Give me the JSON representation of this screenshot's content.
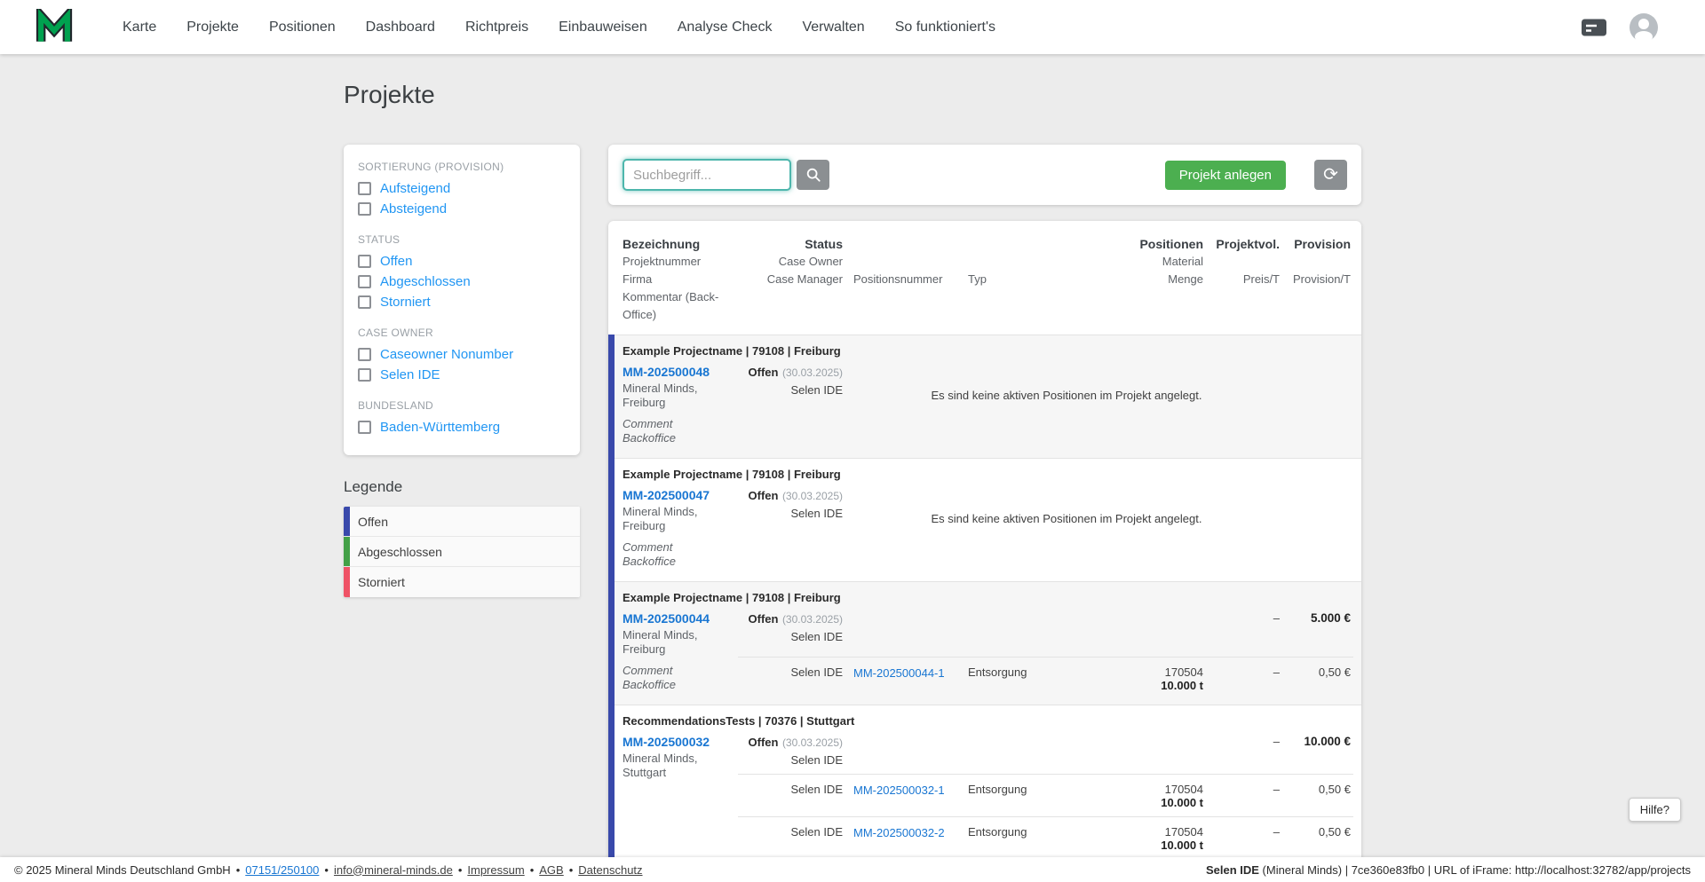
{
  "navbar": {
    "items": [
      "Karte",
      "Projekte",
      "Positionen",
      "Dashboard",
      "Richtpreis",
      "Einbauweisen",
      "Analyse Check",
      "Verwalten",
      "So funktioniert's"
    ]
  },
  "page": {
    "title": "Projekte"
  },
  "filters": {
    "sections": [
      {
        "label": "SORTIERUNG (PROVISION)",
        "options": [
          "Aufsteigend",
          "Absteigend"
        ]
      },
      {
        "label": "STATUS",
        "options": [
          "Offen",
          "Abgeschlossen",
          "Storniert"
        ]
      },
      {
        "label": "CASE OWNER",
        "options": [
          "Caseowner Nonumber",
          "Selen IDE"
        ]
      },
      {
        "label": "BUNDESLAND",
        "options": [
          "Baden-Württemberg"
        ]
      }
    ]
  },
  "legend": {
    "title": "Legende",
    "items": [
      {
        "label": "Offen",
        "color": "#3949ab"
      },
      {
        "label": "Abgeschlossen",
        "color": "#43a047"
      },
      {
        "label": "Storniert",
        "color": "#ef5266"
      }
    ]
  },
  "toolbar": {
    "search_placeholder": "Suchbegriff...",
    "create_button": "Projekt anlegen"
  },
  "icons": {
    "refresh_glyph": "⟳"
  },
  "colors": {
    "primary_green": "#4caf50",
    "status_open": "#3949ab",
    "status_done": "#43a047",
    "status_cancelled": "#ef5266",
    "link_blue": "#1976d2",
    "search_focus_teal": "#4db6ac"
  },
  "table": {
    "header": {
      "bezeichnung": "Bezeichnung",
      "projektnummer": "Projektnummer",
      "firma": "Firma",
      "kommentar": "Kommentar (Back-Office)",
      "status": "Status",
      "case_owner": "Case Owner",
      "case_manager": "Case Manager",
      "positionsnummer": "Positionsnummer",
      "typ": "Typ",
      "positionen": "Positionen",
      "material": "Material",
      "menge": "Menge",
      "projektvol": "Projektvol.",
      "preis_t": "Preis/T",
      "provision": "Provision",
      "provision_t": "Provision/T"
    },
    "projects": [
      {
        "title": "Example Projectname | 79108 | Freiburg",
        "number": "MM-202500048",
        "company": "Mineral Minds, Freiburg",
        "comment": "Comment Backoffice",
        "status": "Offen",
        "status_date": "(30.03.2025)",
        "case_owner": "Selen IDE",
        "projektvol": "",
        "provision": "",
        "empty_message": "Es sind keine aktiven Positionen im Projekt angelegt.",
        "positions": []
      },
      {
        "title": "Example Projectname | 79108 | Freiburg",
        "number": "MM-202500047",
        "company": "Mineral Minds, Freiburg",
        "comment": "Comment Backoffice",
        "status": "Offen",
        "status_date": "(30.03.2025)",
        "case_owner": "Selen IDE",
        "projektvol": "",
        "provision": "",
        "empty_message": "Es sind keine aktiven Positionen im Projekt angelegt.",
        "positions": []
      },
      {
        "title": "Example Projectname | 79108 | Freiburg",
        "number": "MM-202500044",
        "company": "Mineral Minds, Freiburg",
        "comment": "Comment Backoffice",
        "status": "Offen",
        "status_date": "(30.03.2025)",
        "case_owner": "Selen IDE",
        "projektvol": "–",
        "provision": "5.000 €",
        "positions": [
          {
            "case_owner": "Selen IDE",
            "number": "MM-202500044-1",
            "typ": "Entsorgung",
            "material": "170504",
            "menge": "10.000 t",
            "preis": "–",
            "provision": "0,50 €"
          }
        ]
      },
      {
        "title": "RecommendationsTests | 70376 | Stuttgart",
        "number": "MM-202500032",
        "company": "Mineral Minds, Stuttgart",
        "comment": "",
        "status": "Offen",
        "status_date": "(30.03.2025)",
        "case_owner": "Selen IDE",
        "projektvol": "–",
        "provision": "10.000 €",
        "positions": [
          {
            "case_owner": "Selen IDE",
            "number": "MM-202500032-1",
            "typ": "Entsorgung",
            "material": "170504",
            "menge": "10.000 t",
            "preis": "–",
            "provision": "0,50 €"
          },
          {
            "case_owner": "Selen IDE",
            "number": "MM-202500032-2",
            "typ": "Entsorgung",
            "material": "170504",
            "menge": "10.000 t",
            "preis": "–",
            "provision": "0,50 €"
          }
        ]
      }
    ]
  },
  "footer": {
    "copyright": "© 2025 Mineral Minds Deutschland GmbH",
    "separator": "•",
    "phone": "07151/250100",
    "email": "info@mineral-minds.de",
    "links": [
      "Impressum",
      "AGB",
      "Datenschutz"
    ],
    "session_bold": "Selen IDE",
    "session_rest": " (Mineral Minds) | 7ce360e83fb0 | URL of iFrame: http://localhost:32782/app/projects"
  },
  "help": {
    "label": "Hilfe?"
  }
}
